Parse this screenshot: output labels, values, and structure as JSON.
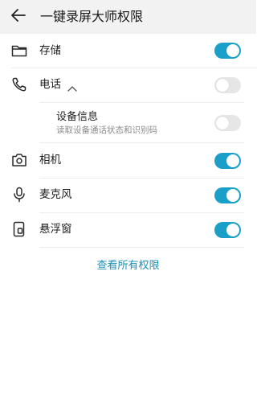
{
  "header": {
    "title": "一键录屏大师权限",
    "back_icon": "arrow-left-icon"
  },
  "permissions": [
    {
      "label": "存储",
      "icon": "folder-icon",
      "enabled": true
    },
    {
      "label": "电话",
      "icon": "phone-icon",
      "enabled": false,
      "expanded": true,
      "children": [
        {
          "title": "设备信息",
          "description": "读取设备通话状态和识别码",
          "enabled": false
        }
      ]
    },
    {
      "label": "相机",
      "icon": "camera-icon",
      "enabled": true
    },
    {
      "label": "麦克风",
      "icon": "microphone-icon",
      "enabled": true
    },
    {
      "label": "悬浮窗",
      "icon": "floating-window-icon",
      "enabled": true
    }
  ],
  "footer": {
    "view_all_label": "查看所有权限"
  },
  "colors": {
    "accent": "#1aa0c8",
    "link": "#1a8fb6",
    "header_bg": "#f2f2f2",
    "toggle_off": "#e6e6e6"
  }
}
